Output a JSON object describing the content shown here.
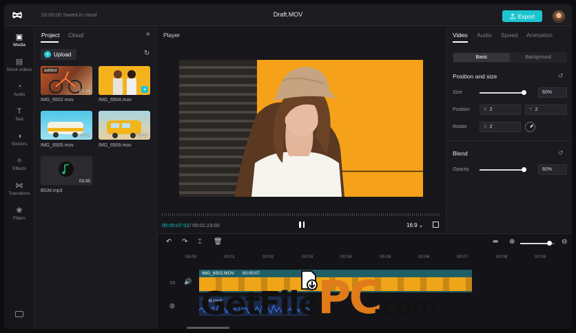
{
  "topbar": {
    "saved_status": "20:00:00 Saved in cloud",
    "title": "Draft.MOV",
    "export_label": "Export"
  },
  "nav": [
    {
      "label": "Media",
      "icon": "media-icon"
    },
    {
      "label": "Stock videos",
      "icon": "stock-videos-icon"
    },
    {
      "label": "Audio",
      "icon": "audio-icon"
    },
    {
      "label": "Text",
      "icon": "text-icon"
    },
    {
      "label": "Stickers",
      "icon": "stickers-icon"
    },
    {
      "label": "Effects",
      "icon": "effects-icon"
    },
    {
      "label": "Transitions",
      "icon": "transitions-icon"
    },
    {
      "label": "Filters",
      "icon": "filters-icon"
    }
  ],
  "media": {
    "tabs": [
      "Project",
      "Cloud"
    ],
    "upload_label": "Upload",
    "items": [
      {
        "name": "IMG_6502.mov",
        "duration": "01:39",
        "badge": "added"
      },
      {
        "name": "IMG_6504.mov",
        "duration": "",
        "badge": ""
      },
      {
        "name": "IMG_6505.mov",
        "duration": "00:06",
        "badge": ""
      },
      {
        "name": "IMG_6509.mov",
        "duration": "00:21",
        "badge": ""
      },
      {
        "name": "BGM.mp3",
        "duration": "03:35",
        "badge": ""
      }
    ]
  },
  "player": {
    "title": "Player",
    "current_time": "00:00:07:02",
    "total_time": "/ 00:01:23:00",
    "ratio": "16:9 ⌄"
  },
  "props": {
    "tabs": [
      "Video",
      "Audio",
      "Speed",
      "Animation"
    ],
    "segment": [
      "Basic",
      "Background"
    ],
    "position_title": "Position and size",
    "size_label": "Size",
    "size_value": "60%",
    "size_level": 0.97,
    "position_label": "Position",
    "pos_x": "2",
    "pos_y": "2",
    "rotate_label": "Rotate",
    "rotate_x": "2",
    "blend_title": "Blend",
    "opacity_label": "Opacity",
    "opacity_value": "60%",
    "opacity_level": 0.97,
    "x_axis": "X",
    "y_axis": "Y"
  },
  "timeline": {
    "ruler": [
      "00:00",
      "00:01",
      "00:02",
      "00:03",
      "00:04",
      "00:05",
      "00:06",
      "00:07",
      "00:08",
      "00:09"
    ],
    "clip_name": "IMG_6502.MOV",
    "clip_time": "00:00:07",
    "audio_name": "BGM.mp3"
  },
  "watermark": {
    "part1": "GetFiles",
    "part2": "PC",
    "part3": ".com"
  },
  "colors": {
    "accent": "#1dc4cf",
    "clip_track": "#1f5f66",
    "preview_bg": "#f5a21a"
  }
}
